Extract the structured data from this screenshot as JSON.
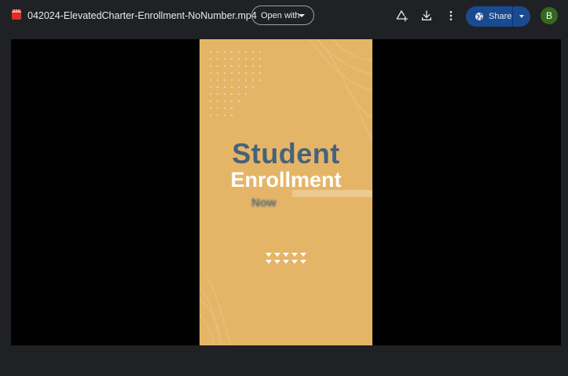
{
  "header": {
    "file_name": "042024-ElevatedCharter-Enrollment-NoNumber.mp4",
    "file_icon": "video-file-icon",
    "open_with_label": "Open with",
    "actions": {
      "add_shortcut_icon": "add-to-drive-icon",
      "download_icon": "download-icon",
      "more_icon": "more-vertical-icon"
    },
    "share": {
      "label": "Share",
      "icon": "globe-icon",
      "dropdown_icon": "caret-down-icon"
    },
    "avatar_initial": "B"
  },
  "video": {
    "headline_line1": "Student",
    "headline_line2": "Enrollment",
    "headline_line3": "Now"
  },
  "colors": {
    "page_background": "#202124",
    "viewer_background": "#000000",
    "video_background": "#e5b567",
    "headline_blue": "#47627a",
    "headline_white": "#ffffff",
    "share_button": "#1a4a8f",
    "avatar": "#33691e",
    "file_icon_red": "#d93025"
  }
}
